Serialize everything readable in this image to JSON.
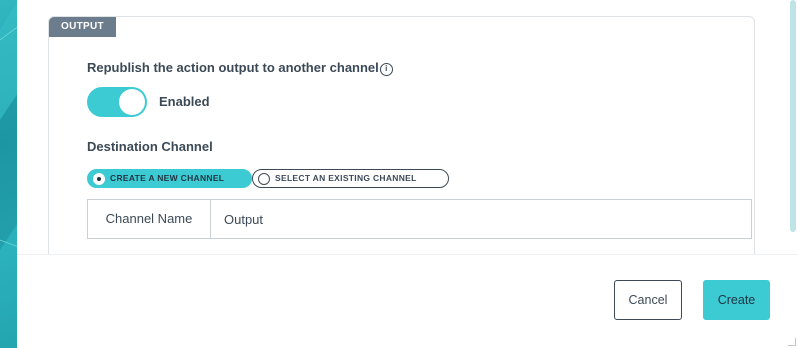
{
  "section": {
    "tag": "OUTPUT"
  },
  "republish": {
    "label": "Republish the action output to another channel",
    "info_icon": "info-icon",
    "toggle_on": true,
    "toggle_label": "Enabled"
  },
  "destination": {
    "label": "Destination Channel",
    "options": [
      {
        "label": "CREATE A NEW CHANNEL",
        "selected": true
      },
      {
        "label": "SELECT AN EXISTING CHANNEL",
        "selected": false
      }
    ],
    "channel_name_label": "Channel Name",
    "channel_name_value": "Output"
  },
  "footer": {
    "cancel_label": "Cancel",
    "create_label": "Create"
  },
  "colors": {
    "accent": "#3ccbd3",
    "text": "#3c4a57",
    "tag_bg": "#6b7c8c"
  }
}
